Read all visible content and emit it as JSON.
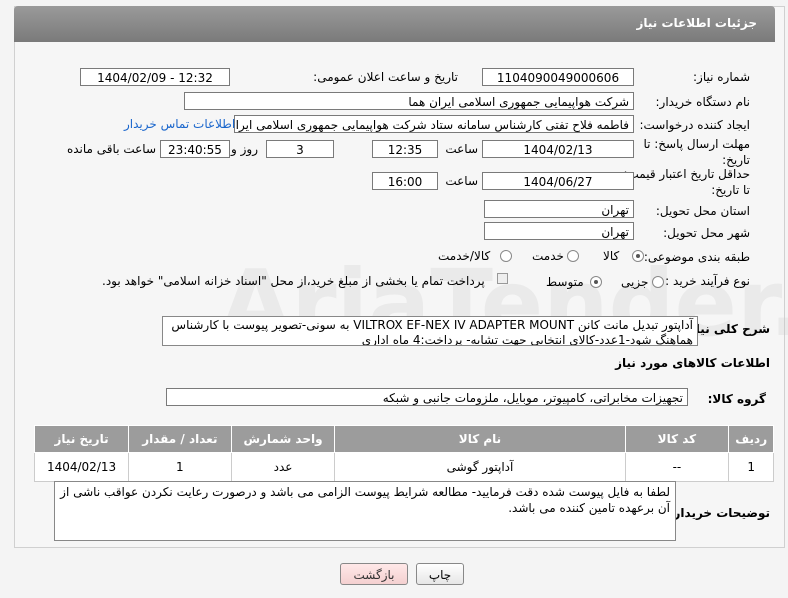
{
  "header": {
    "title": "جزئیات اطلاعات نیاز"
  },
  "form": {
    "need_number_label": "شماره نیاز:",
    "need_number": "1104090049000606",
    "announce_label": "تاریخ و ساعت اعلان عمومی:",
    "announce_value": "1404/02/09 - 12:32",
    "buyer_org_label": "نام دستگاه خریدار:",
    "buyer_org": "شرکت هواپیمایی جمهوری اسلامی ایران هما",
    "creator_label": "ایجاد کننده درخواست:",
    "creator": "فاطمه فلاح تفتی کارشناس سامانه ستاد شرکت هواپیمایی جمهوری اسلامی ایران هما",
    "contact_link": "اطلاعات تماس خریدار",
    "deadline_label": "مهلت ارسال پاسخ: تا تاریخ:",
    "deadline_date": "1404/02/13",
    "time_label": "ساعت",
    "deadline_time": "12:35",
    "days_value": "3",
    "days_label": "روز و",
    "remaining_time": "23:40:55",
    "remaining_label": "ساعت باقی مانده",
    "validity_label": "حداقل تاریخ اعتبار قیمت: تا تاریخ:",
    "validity_date": "1404/06/27",
    "validity_time": "16:00",
    "province_label": "استان محل تحویل:",
    "province": "تهران",
    "city_label": "شهر محل تحویل:",
    "city": "تهران",
    "category_label": "طبقه بندی موضوعی:",
    "category_options": [
      "کالا",
      "خدمت",
      "کالا/خدمت"
    ],
    "category_selected": "کالا",
    "process_label": "نوع فرآیند خرید :",
    "process_options": [
      "جزیی",
      "متوسط"
    ],
    "process_selected": "متوسط",
    "payment_note": "پرداخت تمام یا بخشی از مبلغ خرید،از محل \"اسناد خزانه اسلامی\" خواهد بود."
  },
  "description": {
    "label": "شرح کلی نیاز:",
    "text": "آداپتور تبدیل مانت کانن VILTROX EF-NEX IV ADAPTER MOUNT به سونی-تصویر پیوست با کارشناس هماهنگ شود-1عدد-کالای انتخابی جهت تشابه- پرداخت:4 ماه اداری"
  },
  "goods": {
    "section_title": "اطلاعات کالاهای مورد نیاز",
    "group_label": "گروه کالا:",
    "group_value": "تجهیزات مخابراتی، کامپیوتر، موبایل، ملزومات جانبی و شبکه",
    "columns": [
      "ردیف",
      "کد کالا",
      "نام کالا",
      "واحد شمارش",
      "تعداد / مقدار",
      "تاریخ نیاز"
    ],
    "rows": [
      [
        "1",
        "--",
        "آداپتور گوشی",
        "عدد",
        "1",
        "1404/02/13"
      ]
    ]
  },
  "buyer_notes": {
    "label": "توضیحات خریدار:",
    "text": "لطفا به فایل پیوست شده دقت فرمایید- مطالعه شرایط پیوست الزامی می باشد و درصورت رعایت نکردن عواقب ناشی از آن برعهده تامین کننده می باشد."
  },
  "buttons": {
    "print": "چاپ",
    "back": "بازگشت"
  },
  "watermark": "AriaTender.neT"
}
